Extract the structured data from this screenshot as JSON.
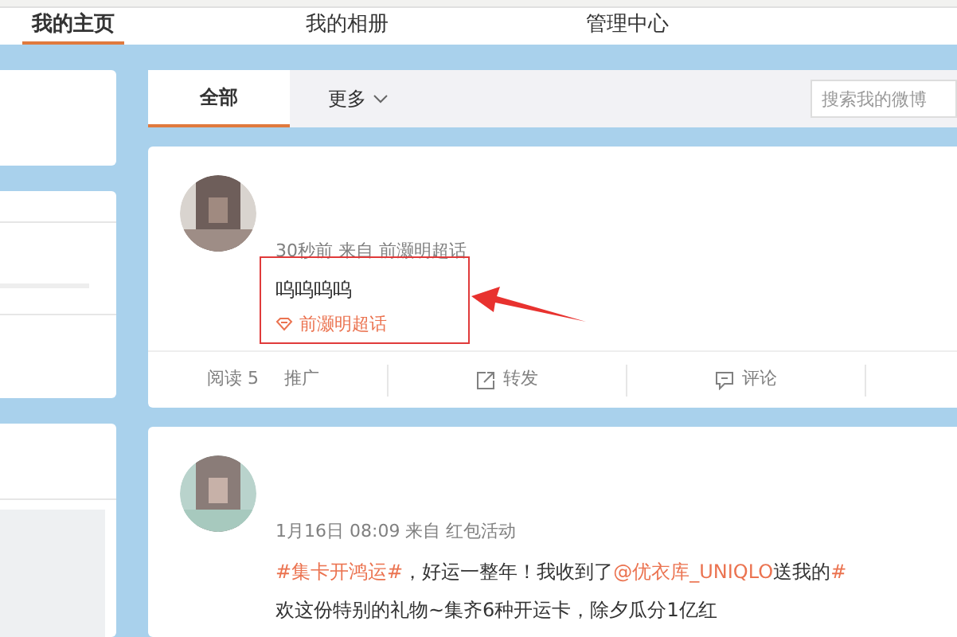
{
  "nav": {
    "tabs": [
      {
        "label": "我的主页",
        "selected": true
      },
      {
        "label": "我的相册",
        "selected": false
      },
      {
        "label": "管理中心",
        "selected": false
      }
    ]
  },
  "feed": {
    "tabs": [
      {
        "label": "全部",
        "selected": true
      }
    ],
    "more": "更多",
    "search": {
      "placeholder": "搜索我的微博"
    }
  },
  "posts": [
    {
      "meta": "30秒前 来自 前灏明超话",
      "highlighted": true,
      "text": "呜呜呜呜",
      "topic": "前灏明超话",
      "footer": {
        "stats": [
          "阅读 5",
          "推广"
        ],
        "actions": [
          {
            "kind": "repost",
            "label": "转发"
          },
          {
            "kind": "comment",
            "label": "评论"
          }
        ]
      }
    },
    {
      "meta": "1月16日 08:09 来自 红包活动",
      "highlighted": false,
      "lines": [
        [
          {
            "kind": "link",
            "text": "#集卡开鸿运#"
          },
          {
            "kind": "plain",
            "text": "，好运一整年！我收到了"
          },
          {
            "kind": "link",
            "text": "@优衣库_UNIQLO"
          },
          {
            "kind": "plain",
            "text": " 送我的"
          },
          {
            "kind": "link",
            "text": "#"
          }
        ],
        [
          {
            "kind": "plain",
            "text": "欢这份特别的礼物~集齐6种开运卡，除夕瓜分1亿红"
          }
        ]
      ]
    }
  ]
}
